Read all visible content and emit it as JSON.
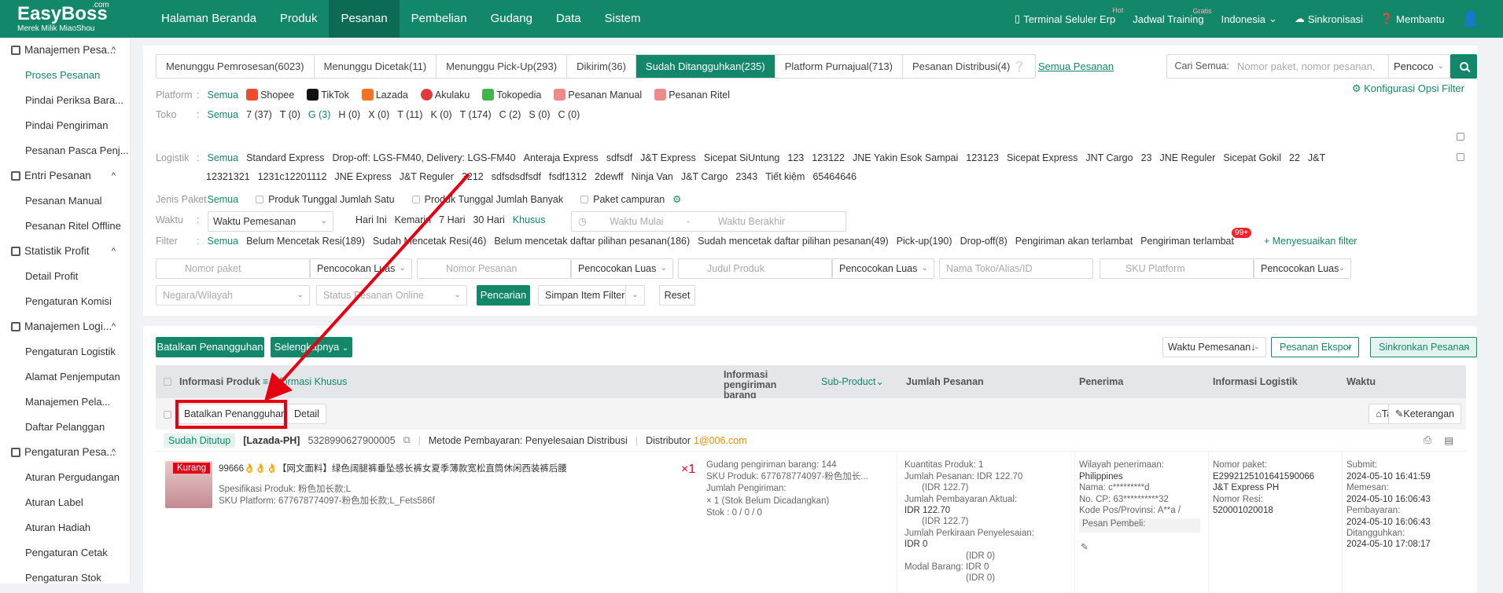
{
  "brand": {
    "name": "EasyBoss",
    "dotcom": ".com",
    "sub": "Merek Milik MiaoShou"
  },
  "nav": [
    "Halaman Beranda",
    "Produk",
    "Pesanan",
    "Pembelian",
    "Gudang",
    "Data",
    "Sistem"
  ],
  "topright": {
    "terminal": "Terminal Seluler Erp",
    "terminal_sup": "Hot",
    "training": "Jadwal Training",
    "training_sup": "Gratis",
    "lang": "Indonesia",
    "sync": "Sinkronisasi",
    "help": "Membantu"
  },
  "sidebar": [
    {
      "group": "Manajemen Pesa...",
      "items": [
        "Proses Pesanan",
        "Pindai Periksa Bara...",
        "Pindai Pengiriman",
        "Pesanan Pasca Penj..."
      ]
    },
    {
      "group": "Entri Pesanan",
      "items": [
        "Pesanan Manual",
        "Pesanan Ritel Offline"
      ]
    },
    {
      "group": "Statistik Profit",
      "items": [
        "Detail Profit",
        "Pengaturan Komisi"
      ]
    },
    {
      "group": "Manajemen Logi...",
      "items": [
        "Pengaturan Logistik",
        "Alamat Penjemputan",
        "Manajemen Pela...",
        "Daftar Pelanggan"
      ]
    },
    {
      "group": "Pengaturan Pesa...",
      "items": [
        "Aturan Pergudangan",
        "Aturan Label",
        "Aturan Hadiah",
        "Pengaturan Cetak",
        "Pengaturan Stok"
      ]
    }
  ],
  "tabs": [
    "Menunggu Pemrosesan(6023)",
    "Menunggu Dicetak(11)",
    "Menunggu Pick-Up(293)",
    "Dikirim(36)",
    "Sudah Ditangguhkan(235)",
    "Platform Purnajual(713)",
    "Pesanan Distribusi(4)"
  ],
  "all_orders": "Semua Pesanan",
  "search": {
    "label": "Cari Semua:",
    "placeholder": "Nomor paket, nomor pesanan,",
    "match": "Pencoco"
  },
  "config": "Konfigurasi Opsi Filter",
  "semua": "Semua",
  "filters": {
    "platform_label": "Platform",
    "platforms": [
      "Shopee",
      "TikTok",
      "Lazada",
      "Akulaku",
      "Tokopedia",
      "Pesanan Manual",
      "Pesanan Ritel"
    ],
    "toko_label": "Toko",
    "toko": [
      "7 (37)",
      "T (0)",
      "G (3)",
      "H (0)",
      "X (0)",
      "T (11)",
      "K (0)",
      "T (174)",
      "C (2)",
      "S (0)",
      "C (0)"
    ],
    "logistik_label": "Logistik",
    "logistik1": [
      "Standard Express",
      "Drop-off: LGS-FM40, Delivery: LGS-FM40",
      "Anteraja Express",
      "sdfsdf",
      "J&T Express",
      "Sicepat SiUntung",
      "123",
      "123122",
      "JNE Yakin Esok Sampai",
      "123123",
      "Sicepat Express",
      "JNT Cargo",
      "23",
      "JNE Reguler",
      "Sicepat Gokil",
      "22",
      "J&T"
    ],
    "logistik2": [
      "12321321",
      "1231c12201112",
      "JNE Express",
      "J&T Reguler",
      "3212",
      "sdfsdsdfsdf",
      "fsdf1312",
      "2dewff",
      "Ninja Van",
      "J&T Cargo",
      "2343",
      "Tiết kiệm",
      "65464646"
    ],
    "jenis_label": "Jenis Paket",
    "jenis": [
      "Produk Tunggal Jumlah Satu",
      "Produk Tunggal Jumlah Banyak",
      "Paket campuran"
    ],
    "waktu_label": "Waktu",
    "waktu_select": "Waktu Pemesanan",
    "waktu": [
      "Hari Ini",
      "Kemarin",
      "7 Hari",
      "30 Hari",
      "Khusus"
    ],
    "start": "Waktu Mulai",
    "dash": "-",
    "end": "Waktu Berakhir",
    "filter_label": "Filter",
    "filter_items": [
      "Belum Mencetak Resi(189)",
      "Sudah Mencetak Resi(46)",
      "Belum mencetak daftar pilihan pesanan(186)",
      "Sudah mencetak daftar pilihan pesanan(49)",
      "Pick-up(190)",
      "Drop-off(8)",
      "Pengiriman akan terlambat",
      "Pengiriman terlambat"
    ],
    "late_badge": "99+",
    "adjust": "+ Menyesuaikan filter"
  },
  "inputs": {
    "nomor_paket": "Nomor paket",
    "nomor_pesanan": "Nomor Pesanan",
    "judul_produk": "Judul Produk",
    "nama_toko": "Nama Toko/Alias/ID",
    "sku_platform": "SKU Platform",
    "match": "Pencocokan Luas",
    "negara": "Negara/Wilayah",
    "status_online": "Status Pesanan Online",
    "cari": "Pencarian",
    "simpan": "Simpan Item Filter",
    "reset": "Reset"
  },
  "actions": {
    "cancel_suspend": "Batalkan Penangguhan",
    "more": "Selengkapnya",
    "sort": "Waktu Pemesanan↓",
    "export": "Pesanan Ekspor",
    "sync": "Sinkronkan Pesanan"
  },
  "table": {
    "headers": [
      "Informasi Produk",
      "Informasi Khusus",
      "Informasi pengiriman barang",
      "Sub-Product",
      "Jumlah Pesanan",
      "Penerima",
      "Informasi Logistik",
      "Waktu"
    ]
  },
  "order": {
    "cancel_btn": "Batalkan Penangguhan",
    "detail_btn": "Detail",
    "tag": "Tag",
    "note": "Keterangan",
    "status": "Sudah Ditutup",
    "store": "[Lazada-PH]",
    "order_no": "5328990627900005",
    "payment": "Metode Pembayaran: Penyelesaian Distribusi",
    "distributor_label": "Distributor",
    "distributor": "1@006.com",
    "kurang": "Kurang",
    "title": "99666👌👌👌【网文面料】绿色阔腿裤垂坠感长裤女夏季薄款宽松直筒休闲西装裤后腰",
    "spec": "Spesifikasi Produk: 粉色加长款;L",
    "sku": "SKU Platform: 677678774097-粉色加长款;L_Fets586f",
    "qty": "×1",
    "gudang": "Gudang pengiriman barang: 144",
    "sku_produk": "SKU Produk: 677678774097-粉色加长...",
    "jumlah_kirim": "Jumlah Pengiriman:",
    "stock_note": "× 1 (Stok Belum Dicadangkan)",
    "stok": "Stok    : 0 / 0 / 0",
    "kuantitas": "Kuantitas Produk: 1",
    "jml_pesanan": "Jumlah Pesanan: IDR 122.70",
    "jml_pesanan_sub": "(IDR 122.7)",
    "jml_bayar": "Jumlah Pembayaran Aktual:",
    "jml_bayar_v": "IDR 122.70",
    "jml_bayar_sub": "(IDR 122.7)",
    "perkiraan": "Jumlah Perkiraan Penyelesaian:",
    "perkiraan_v": "IDR 0",
    "perkiraan_sub": "(IDR 0)",
    "modal": "Modal Barang: IDR 0",
    "modal_sub": "(IDR 0)",
    "wilayah": "Wilayah penerimaan:",
    "wilayah_v": "Philippines",
    "nama": "Nama: c*********d",
    "cp": "No. CP: 63**********32",
    "kodepos": "Kode Pos/Provinsi: A**a /",
    "pembeli": "Pesan Pembeli:",
    "nomor_paket": "Nomor paket:",
    "nomor_paket_v": "E2992125101641590066",
    "kurir": "J&T Express PH",
    "nomor_resi": "Nomor Resi:",
    "nomor_resi_v": "520001020018",
    "submit": "Submit:",
    "submit_v": "2024-05-10 16:41:59",
    "memesan": "Memesan:",
    "memesan_v": "2024-05-10 16:06:43",
    "pembayaran": "Pembayaran:",
    "pembayaran_v": "2024-05-10 16:06:43",
    "ditangguhkan": "Ditangguhkan:",
    "ditangguhkan_v": "2024-05-10 17:08:17"
  },
  "colors": {
    "brand": "#12876a",
    "highlight": "#e60012"
  }
}
